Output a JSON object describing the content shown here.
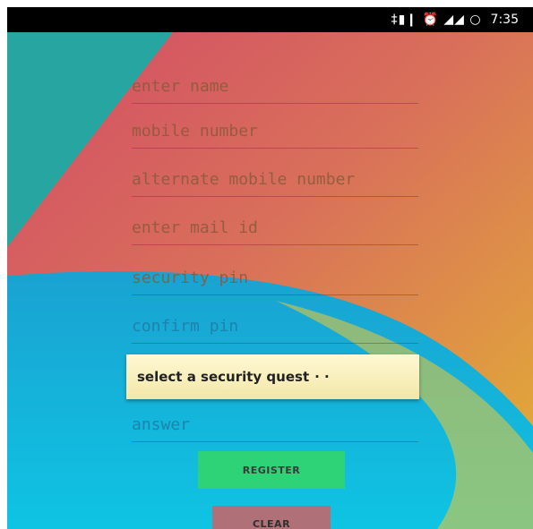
{
  "status_bar": {
    "icons": "‡▮❙ ⏰ ◢◢ ○",
    "time": "7:35"
  },
  "form": {
    "name_hint": "enter name",
    "mobile_hint": "mobile number",
    "alt_mobile_hint": "alternate mobile number",
    "mail_hint": "enter mail id",
    "pin_hint": "security pin",
    "confirm_pin_hint": "confirm pin",
    "security_question": "select a security quest",
    "security_question_more": "· ·",
    "answer_hint": "answer"
  },
  "buttons": {
    "register": "REGISTER",
    "clear": "CLEAR"
  },
  "colors": {
    "register_bg": "#2ed277",
    "clear_bg": "#b07077",
    "spinner_bg": "#f6eeb8"
  }
}
